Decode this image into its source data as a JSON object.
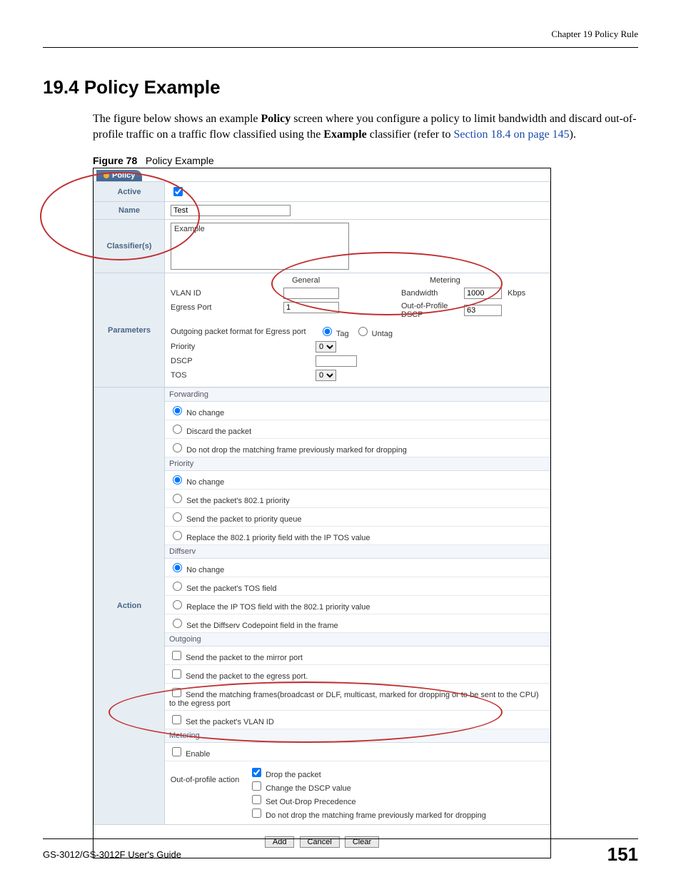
{
  "chapter_head": "Chapter 19 Policy Rule",
  "section_title": "19.4  Policy Example",
  "body": {
    "pre": "The figure below shows an example ",
    "bold1": "Policy",
    "mid1": " screen where you configure a policy to limit bandwidth and discard out-of-profile traffic on a traffic flow classified using the ",
    "bold2": "Example",
    "mid2": " classifier (refer to ",
    "link": "Section 18.4 on page 145",
    "post": ")."
  },
  "figure": {
    "label": "Figure 78",
    "title": "Policy Example"
  },
  "form": {
    "tab": "Policy",
    "rows": {
      "active": "Active",
      "name": "Name",
      "classifiers": "Classifier(s)",
      "parameters": "Parameters",
      "action": "Action"
    },
    "name_value": "Test",
    "classifier_value": "Example",
    "params": {
      "general_head": "General",
      "metering_head": "Metering",
      "vlan_id": "VLAN ID",
      "bandwidth": "Bandwidth",
      "bandwidth_value": "1000",
      "kbps": "Kbps",
      "egress_port": "Egress Port",
      "egress_port_value": "1",
      "oop_dscp": "Out-of-Profile DSCP",
      "oop_dscp_value": "63",
      "format": "Outgoing packet format for Egress port",
      "tag": "Tag",
      "untag": "Untag",
      "priority": "Priority",
      "priority_value": "0",
      "dscp": "DSCP",
      "tos": "TOS",
      "tos_value": "0"
    },
    "action": {
      "forwarding_head": "Forwarding",
      "fwd_no_change": "No change",
      "fwd_discard": "Discard the packet",
      "fwd_nodrop": "Do not drop the matching frame previously marked for dropping",
      "priority_head": "Priority",
      "pri_no_change": "No change",
      "pri_set8021": "Set the packet's 802.1 priority",
      "pri_sendq": "Send the packet to priority queue",
      "pri_replace": "Replace the 802.1 priority field with the IP TOS value",
      "diffserv_head": "Diffserv",
      "ds_no_change": "No change",
      "ds_settos": "Set the packet's TOS field",
      "ds_replaceip": "Replace the IP TOS field with the 802.1 priority value",
      "ds_setcp": "Set the Diffserv Codepoint field in the frame",
      "outgoing_head": "Outgoing",
      "out_mirror": "Send the packet to the mirror port",
      "out_egress": "Send the packet to the egress port.",
      "out_matching": "Send the matching frames(broadcast or DLF, multicast, marked for dropping or to be sent to the CPU) to the egress port",
      "out_setvlan": "Set the packet's VLAN ID",
      "metering_head": "Metering",
      "met_enable": "Enable",
      "oop_label": "Out-of-profile action",
      "oop_drop": "Drop the packet",
      "oop_change": "Change the DSCP value",
      "oop_setprec": "Set Out-Drop Precedence",
      "oop_nodrop": "Do not drop the matching frame previously marked for dropping"
    },
    "buttons": {
      "add": "Add",
      "cancel": "Cancel",
      "clear": "Clear"
    }
  },
  "footer": {
    "guide": "GS-3012/GS-3012F User's Guide",
    "page": "151"
  }
}
